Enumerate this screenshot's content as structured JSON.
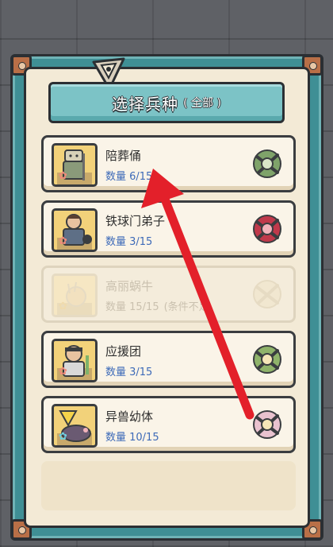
{
  "header": {
    "title": "选择兵种",
    "subtitle": "( 全部 )"
  },
  "units": [
    {
      "name": "陪葬俑",
      "count": "数量 6/15",
      "note": "",
      "star_color": "#f08a7a",
      "faction_color": "#7fa36a",
      "portrait_color": "#f2d27a",
      "disabled": false
    },
    {
      "name": "铁球门弟子",
      "count": "数量 3/15",
      "note": "",
      "star_color": "#f08a7a",
      "faction_color": "#c0394b",
      "portrait_color": "#f2d27a",
      "disabled": false
    },
    {
      "name": "高丽蜗牛",
      "count": "数量 15/15",
      "note": "(条件不足",
      "star_color": "#f0d7a0",
      "faction_color": "#e8d9b0",
      "portrait_color": "#f7e7bd",
      "disabled": true
    },
    {
      "name": "应援团",
      "count": "数量 3/15",
      "note": "",
      "star_color": "#f08a7a",
      "faction_color": "#8fb36a",
      "portrait_color": "#f2d27a",
      "disabled": false
    },
    {
      "name": "异兽幼体",
      "count": "数量 10/15",
      "note": "",
      "star_color": "#6fd0e0",
      "faction_color": "#e9c2cf",
      "portrait_color": "#f2d27a",
      "disabled": false
    }
  ],
  "colors": {
    "frame_teal": "#3f8f95",
    "panel_cream": "#f3ead6",
    "count_blue": "#3d6ab8",
    "arrow_red": "#e3202a"
  },
  "icons": [
    "emblem-icon",
    "star-icon",
    "faction-icon",
    "red-arrow-icon"
  ]
}
